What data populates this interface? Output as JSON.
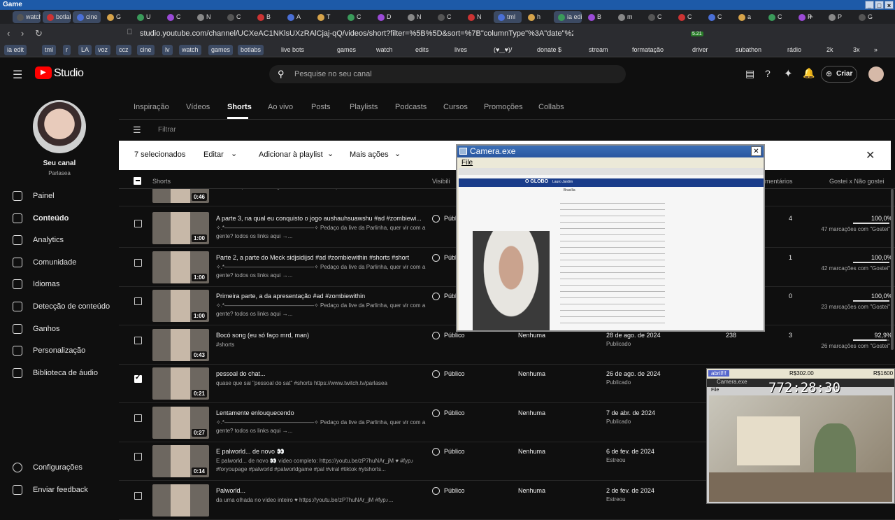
{
  "os_title": "Game",
  "browser": {
    "tabs": [
      "watch",
      "botlabs",
      "cine",
      "G",
      "U",
      "C",
      "N",
      "C",
      "B",
      "A",
      "T",
      "C",
      "D",
      "N",
      "C",
      "N",
      "tml",
      "h",
      "ia edit",
      "B",
      "m",
      "C",
      "C",
      "C",
      "a",
      "C",
      "P",
      "P",
      "G"
    ],
    "url": "studio.youtube.com/channel/UCXeAC1NKlsUXzRAlCjaj-qQ/videos/short?filter=%5B%5D&sort=%7B\"columnType\"%3A\"date\"%2C\"sortOrder\"...",
    "bookmarks": [
      "ia edit",
      "tml",
      "r",
      "LA",
      "voz",
      "ccz",
      "cine",
      "lv",
      "watch",
      "games",
      "botlabs",
      "live bots",
      "games",
      "watch",
      "edits",
      "lives",
      "(♥‿♥)/",
      "donate $",
      "stream",
      "formatação",
      "driver",
      "subathon",
      "rádio",
      "2k",
      "3x"
    ],
    "ext_badge": "5.21"
  },
  "studio": {
    "logo": "Studio",
    "search_placeholder": "Pesquise no seu canal",
    "create_label": "Criar"
  },
  "sidebar": {
    "channel_title": "Seu canal",
    "channel_name": "Parlasea",
    "items": [
      {
        "label": "Painel",
        "icon": "dashboard-icon"
      },
      {
        "label": "Conteúdo",
        "icon": "content-icon"
      },
      {
        "label": "Analytics",
        "icon": "analytics-icon"
      },
      {
        "label": "Comunidade",
        "icon": "community-icon"
      },
      {
        "label": "Idiomas",
        "icon": "languages-icon"
      },
      {
        "label": "Detecção de conteúdo",
        "icon": "detection-icon"
      },
      {
        "label": "Ganhos",
        "icon": "earnings-icon"
      },
      {
        "label": "Personalização",
        "icon": "customization-icon"
      },
      {
        "label": "Biblioteca de áudio",
        "icon": "audio-library-icon"
      }
    ],
    "settings": "Configurações",
    "feedback": "Enviar feedback"
  },
  "content_tabs": [
    "Inspiração",
    "Vídeos",
    "Shorts",
    "Ao vivo",
    "Posts",
    "Playlists",
    "Podcasts",
    "Cursos",
    "Promoções",
    "Collabs"
  ],
  "filter_placeholder": "Filtrar",
  "action_bar": {
    "selected": "7 selecionados",
    "edit": "Editar",
    "add_playlist": "Adicionar à playlist",
    "more_actions": "Mais ações"
  },
  "columns": {
    "shorts": "Shorts",
    "visibility": "Visibili",
    "comments": "mentários",
    "likes_ratio": "Gostei x Não gostei"
  },
  "rows": [
    {
      "duration": "0:46",
      "title": "",
      "desc": "Parlinha, quer vir com a gente? todos os links aqui →...",
      "visibility": "",
      "restrictions": "",
      "date": "",
      "date_status": "",
      "views": "",
      "comments": "",
      "pct": "",
      "likes": "",
      "checked": false
    },
    {
      "duration": "1:00",
      "title": "A parte 3, na qual eu conquisto o jogo aushauhsuawshu #ad #zombiewi...",
      "desc": "✧.*————————————————✧ Pedaço da live da Parlinha, quer vir com a gente? todos os links aqui →...",
      "visibility": "Públ",
      "restrictions": "",
      "date": "",
      "date_status": "",
      "views": "",
      "comments": "4",
      "pct": "100,0%",
      "likes": "47 marcações com \"Gostei\"",
      "checked": false
    },
    {
      "duration": "1:00",
      "title": "Parte 2, a parte do Meck sidjsidijsd #ad #zombiewithin #shorts #short",
      "desc": "✧.*————————————————✧ Pedaço da live da Parlinha, quer vir com a gente? todos os links aqui →...",
      "visibility": "Públ",
      "restrictions": "",
      "date": "",
      "date_status": "",
      "views": "",
      "comments": "1",
      "pct": "100,0%",
      "likes": "42 marcações com \"Gostei\"",
      "checked": false
    },
    {
      "duration": "1:00",
      "title": "Primeira parte, a da apresentação #ad #zombiewithin",
      "desc": "✧.*————————————————✧ Pedaço da live da Parlinha, quer vir com a gente? todos os links aqui →...",
      "visibility": "Públ",
      "restrictions": "",
      "date": "",
      "date_status": "",
      "views": "",
      "comments": "0",
      "pct": "100,0%",
      "likes": "23 marcações com \"Gostei\"",
      "checked": false
    },
    {
      "duration": "0:43",
      "title": "Bocó song (eu só faço mrd, man)",
      "desc": "#shorts",
      "visibility": "Público",
      "restrictions": "Nenhuma",
      "date": "28 de ago. de 2024",
      "date_status": "Publicado",
      "views": "238",
      "comments": "3",
      "pct": "92,9%",
      "likes": "26 marcações com \"Gostei\"",
      "checked": false
    },
    {
      "duration": "0:21",
      "title": "pessoal do chat...",
      "desc": "quase que sai \"pessoal do sat\" #shorts https://www.twitch.tv/parlasea",
      "visibility": "Público",
      "restrictions": "Nenhuma",
      "date": "26 de ago. de 2024",
      "date_status": "Publicado",
      "views": "",
      "comments": "",
      "pct": "",
      "likes": "",
      "checked": true
    },
    {
      "duration": "0:27",
      "title": "Lentamente enlouquecendo",
      "desc": "✧.*————————————————✧ Pedaço da live da Parlinha, quer vir com a gente? todos os links aqui →...",
      "visibility": "Público",
      "restrictions": "Nenhuma",
      "date": "7 de abr. de 2024",
      "date_status": "Publicado",
      "views": "",
      "comments": "",
      "pct": "",
      "likes": "",
      "checked": false
    },
    {
      "duration": "0:14",
      "title": "E palworld... de novo 👀",
      "desc": "E palworld... de novo 👀 vídeo completo: https://youtu.be/zP7huNAr_jM ♥ #fyp♪ #foryoupage #palworld #palworldgame #pal #viral #tiktok #ytshorts...",
      "visibility": "Público",
      "restrictions": "Nenhuma",
      "date": "6 de fev. de 2024",
      "date_status": "Estreou",
      "views": "",
      "comments": "",
      "pct": "",
      "likes": "",
      "checked": false
    },
    {
      "duration": "",
      "title": "Palworld...",
      "desc": "da uma olhada no vídeo inteiro ♥ https://youtu.be/zP7huNAr_jM #fyp♪...",
      "visibility": "Público",
      "restrictions": "Nenhuma",
      "date": "2 de fev. de 2024",
      "date_status": "Estreou",
      "views": "",
      "comments": "",
      "pct": "",
      "likes": "",
      "checked": false
    }
  ],
  "camera_window": {
    "title": "Camera.exe",
    "menu": "File",
    "news_brand": "O GLOBO",
    "news_author": "Lauro Jardim",
    "news_section": "Brasília"
  },
  "stream_overlay": {
    "label_left": "abril!!!",
    "amount1": "R$302.00",
    "amount2": "R$1600",
    "window_title": "Camera.exe",
    "menu": "File",
    "timer": "772:28:30"
  }
}
